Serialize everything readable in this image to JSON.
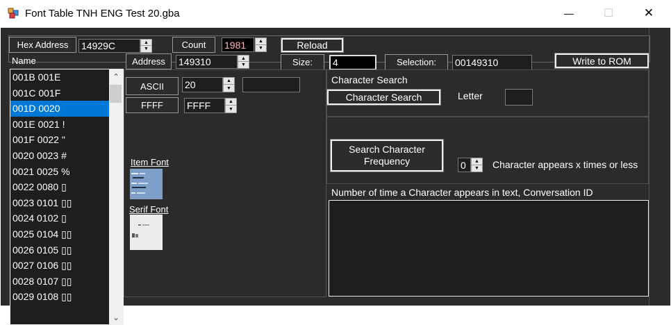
{
  "window": {
    "title": "Font Table TNH ENG Test 20.gba",
    "minimize": "—",
    "maximize": "☐",
    "close": "✕"
  },
  "toolbar": {
    "hex_address_label": "Hex Address",
    "hex_address_value": "14929C",
    "count_label": "Count",
    "count_value": "1981",
    "reload_label": "Reload"
  },
  "row2": {
    "name_label": "Name",
    "address_label": "Address",
    "address_value": "149310",
    "size_label": "Size:",
    "size_value": "4",
    "selection_label": "Selection:",
    "selection_value": "00149310",
    "write_rom_label": "Write to ROM"
  },
  "list": {
    "items": [
      "001B 001E",
      "001C 001F",
      "001D 0020",
      "001E 0021 !",
      "001F 0022 \"",
      "0020 0023 #",
      "0021 0025 %",
      "0022 0080 ▯",
      "0023 0101 ▯▯",
      "0024 0102  ▯",
      "0025 0104 ▯▯",
      "0026 0105 ▯▯",
      "0027 0106 ▯▯",
      "0028 0107 ▯▯",
      "0029 0108 ▯▯"
    ],
    "selected_index": 2
  },
  "editor": {
    "ascii_label": "ASCII",
    "ascii_value": "20",
    "ascii_char_value": "",
    "ffff_label": "FFFF",
    "ffff_value": "FFFF",
    "item_font_label": "Item Font",
    "serif_font_label": "Serif Font"
  },
  "search": {
    "group_title": "Character Search",
    "search_button": "Character Search",
    "letter_label": "Letter",
    "letter_value": "",
    "frequency_button": "Search Character Frequency",
    "frequency_value": "0",
    "frequency_hint": "Character appears x times or less",
    "results_header": "Number of time a Character appears in text, Conversation ID"
  },
  "colors": {
    "background": "#2b2b2b",
    "field": "#1e1e1e",
    "selection": "#0078d7",
    "text": "#ffffff"
  }
}
